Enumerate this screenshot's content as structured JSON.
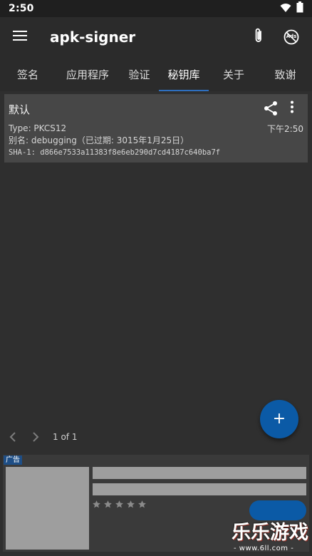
{
  "status_bar": {
    "time": "2:50"
  },
  "app_bar": {
    "title": "apk-signer",
    "ads_badge": "Ads"
  },
  "tabs": [
    {
      "label": "签名"
    },
    {
      "label": "应用程序"
    },
    {
      "label": "验证"
    },
    {
      "label": "秘钥库",
      "active": true
    },
    {
      "label": "关于"
    },
    {
      "label": "致谢"
    }
  ],
  "keystore_card": {
    "title": "默认",
    "time": "下午2:50",
    "type_line": "Type: PKCS12",
    "alias_line": "别名: debugging（已过期: 3015年1月25日）",
    "sha1_line": "SHA-1: d866e7533a11383f8e6eb290d7cd4187c640ba7f"
  },
  "pager": {
    "label": "1 of 1"
  },
  "fab": {
    "symbol": "+"
  },
  "ad": {
    "tag": "广告",
    "rating_stars": 5
  },
  "watermark": {
    "big": "乐乐游戏",
    "small": "- www.6ll.com -"
  },
  "colors": {
    "accent": "#0b5aa6",
    "tab_indicator": "#2e6fbf",
    "background": "#2f2f2f",
    "card": "#474747"
  },
  "icons": [
    "menu-icon",
    "attachment-icon",
    "no-ads-icon",
    "share-icon",
    "more-vert-icon",
    "chevron-left-icon",
    "chevron-right-icon",
    "add-icon",
    "wifi-icon",
    "battery-icon"
  ]
}
